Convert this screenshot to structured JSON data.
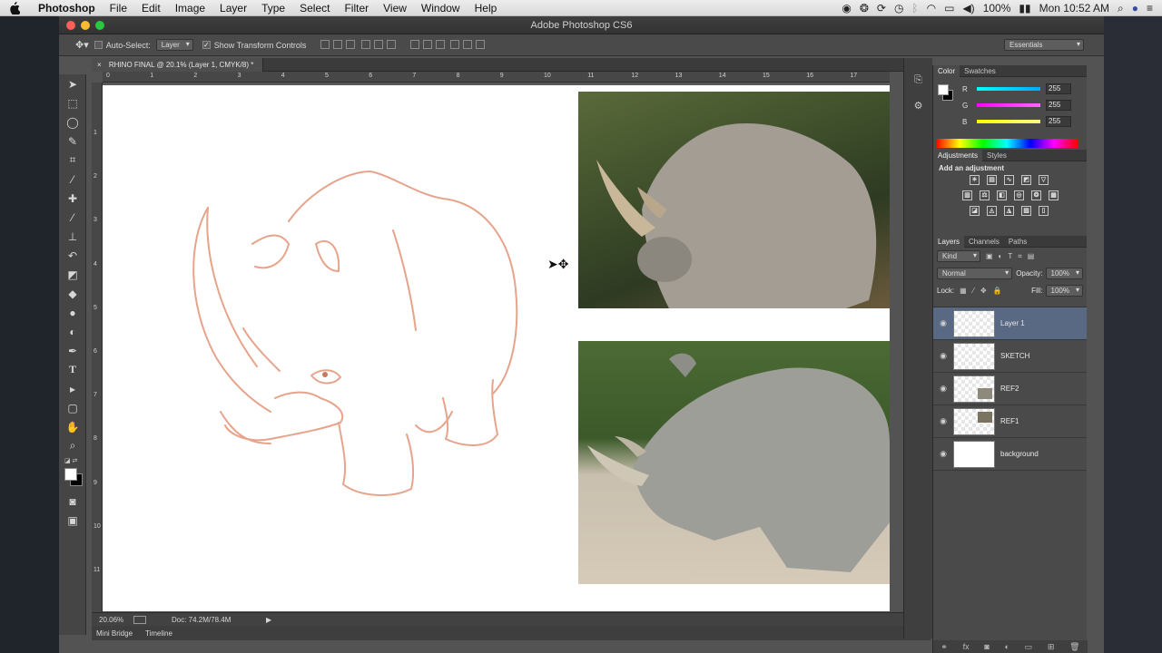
{
  "menubar": {
    "app": "Photoshop",
    "items": [
      "File",
      "Edit",
      "Image",
      "Layer",
      "Type",
      "Select",
      "Filter",
      "View",
      "Window",
      "Help"
    ],
    "battery": "100%",
    "clock": "Mon 10:52 AM"
  },
  "window": {
    "title": "Adobe Photoshop CS6"
  },
  "options": {
    "auto_select_label": "Auto-Select:",
    "auto_select_value": "Layer",
    "show_transform_label": "Show Transform Controls",
    "workspace": "Essentials"
  },
  "document": {
    "tab_title": "RHINO FINAL @ 20.1% (Layer 1, CMYK/8) *",
    "zoom": "20.06%",
    "doc_size": "Doc: 74.2M/78.4M",
    "h_ruler": [
      "0",
      "1",
      "2",
      "3",
      "4",
      "5",
      "6",
      "7",
      "8",
      "9",
      "10",
      "11",
      "12",
      "13",
      "14",
      "15",
      "16",
      "17"
    ],
    "v_ruler": [
      "1",
      "2",
      "3",
      "4",
      "5",
      "6",
      "7",
      "8",
      "9",
      "10",
      "11"
    ]
  },
  "bottom_tabs": [
    "Mini Bridge",
    "Timeline"
  ],
  "color_panel": {
    "tabs": [
      "Color",
      "Swatches"
    ],
    "channels": [
      {
        "label": "R",
        "value": "255",
        "color": "#00c8ff"
      },
      {
        "label": "G",
        "value": "255",
        "color": "#ff40ff"
      },
      {
        "label": "B",
        "value": "255",
        "color": "#ffff40"
      }
    ]
  },
  "adjustments_panel": {
    "tabs": [
      "Adjustments",
      "Styles"
    ],
    "hint": "Add an adjustment"
  },
  "layers_panel": {
    "tabs": [
      "Layers",
      "Channels",
      "Paths"
    ],
    "kind": "Kind",
    "blend_mode": "Normal",
    "opacity_label": "Opacity:",
    "opacity": "100%",
    "lock_label": "Lock:",
    "fill_label": "Fill:",
    "fill": "100%",
    "layers": [
      "Layer 1",
      "SKETCH",
      "REF2",
      "REF1",
      "background"
    ]
  }
}
